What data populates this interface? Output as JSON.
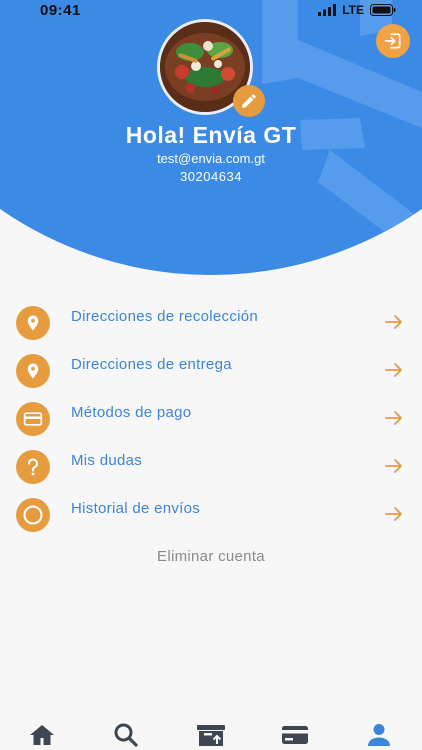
{
  "status_bar": {
    "time": "09:41",
    "network": "LTE"
  },
  "profile": {
    "greeting": "Hola! Envía GT",
    "email": "test@envia.com.gt",
    "phone": "30204634"
  },
  "menu": {
    "items": [
      {
        "label": "Direcciones de recolección",
        "icon": "location-pin-icon"
      },
      {
        "label": "Direcciones de entrega",
        "icon": "location-pin-icon"
      },
      {
        "label": "Métodos de pago",
        "icon": "credit-card-icon"
      },
      {
        "label": "Mis dudas",
        "icon": "question-icon"
      },
      {
        "label": "Historial de envíos",
        "icon": "circle-icon"
      }
    ]
  },
  "delete_account_label": "Eliminar cuenta",
  "tab_bar": {
    "items": [
      {
        "icon": "home-icon",
        "active": false
      },
      {
        "icon": "search-icon",
        "active": false
      },
      {
        "icon": "package-upload-icon",
        "active": false
      },
      {
        "icon": "payment-card-icon",
        "active": false
      },
      {
        "icon": "user-icon",
        "active": true
      }
    ]
  },
  "colors": {
    "header_blue": "#3b8ae6",
    "accent_orange": "#e69b3f",
    "link_blue": "#3b86d9",
    "muted_gray": "#8a8a8a",
    "tab_inactive": "#3e4651",
    "tab_active": "#3b86d9"
  }
}
